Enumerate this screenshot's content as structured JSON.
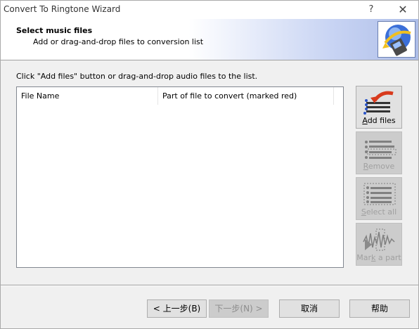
{
  "window": {
    "title": "Convert To Ringtone Wizard",
    "help_glyph": "?",
    "close_glyph": "✕"
  },
  "header": {
    "title": "Select music files",
    "subtitle": "Add or drag-and-drop files to conversion list",
    "logo_icon": "phone-music-logo-icon"
  },
  "instruction": "Click \"Add files\" button or drag-and-drop audio files to the list.",
  "file_list": {
    "columns": [
      "File Name",
      "Part of file to convert (marked red)"
    ],
    "rows": []
  },
  "side_buttons": [
    {
      "pre": "",
      "key": "A",
      "post": "dd files",
      "enabled": true,
      "icon": "add-files-icon"
    },
    {
      "pre": "",
      "key": "R",
      "post": "emove",
      "enabled": false,
      "icon": "remove-icon"
    },
    {
      "pre": "",
      "key": "S",
      "post": "elect all",
      "enabled": false,
      "icon": "select-all-icon"
    },
    {
      "pre": "Mar",
      "key": "k",
      "post": " a part",
      "enabled": false,
      "icon": "mark-part-icon"
    }
  ],
  "bottom_buttons": {
    "back": "< 上一步(B)",
    "next": "下一步(N) >",
    "cancel": "取消",
    "help": "帮助"
  },
  "colors": {
    "header_gradient_end": "#aebee8",
    "accent_red": "#d83a1c",
    "disabled_face": "#cccccc"
  }
}
